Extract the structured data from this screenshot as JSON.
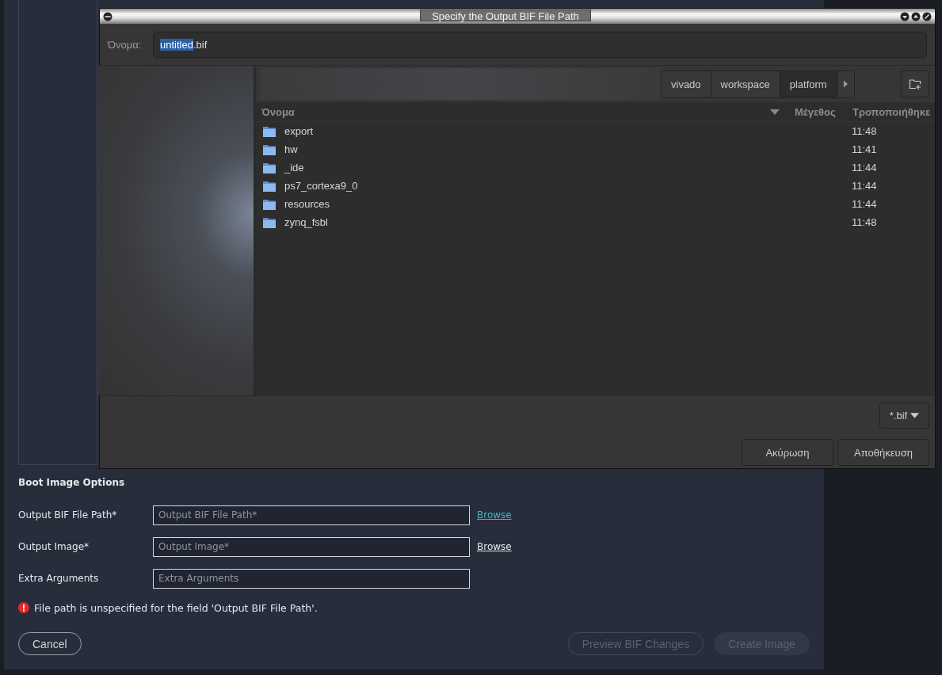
{
  "file_dialog": {
    "title": "Specify the Output BIF File Path",
    "name_label": "Όνομα:",
    "name_field": {
      "selected_text": "untitled",
      "rest_text": ".bif"
    },
    "breadcrumbs": [
      {
        "label": "vivado",
        "selected": false
      },
      {
        "label": "workspace",
        "selected": false
      },
      {
        "label": "platform",
        "selected": true
      }
    ],
    "columns": [
      "Όνομα",
      "Μέγεθος",
      "Τροποποιήθηκε"
    ],
    "files": [
      {
        "name": "export",
        "modified": "11:48"
      },
      {
        "name": "hw",
        "modified": "11:41"
      },
      {
        "name": "_ide",
        "modified": "11:44"
      },
      {
        "name": "ps7_cortexa9_0",
        "modified": "11:44"
      },
      {
        "name": "resources",
        "modified": "11:44"
      },
      {
        "name": "zynq_fsbl",
        "modified": "11:48"
      }
    ],
    "filter": "*.bif",
    "buttons": [
      "Ακύρωση",
      "Αποθήκευση"
    ]
  },
  "boot_image": {
    "heading": "Boot Image Options",
    "fields": [
      {
        "label": "Output BIF File Path*",
        "placeholder": "Output BIF File Path*",
        "browse": {
          "label": "Browse",
          "highlighted": true
        }
      },
      {
        "label": "Output Image*",
        "placeholder": "Output Image*",
        "browse": {
          "label": "Browse",
          "highlighted": false
        }
      },
      {
        "label": "Extra Arguments",
        "placeholder": "Extra Arguments"
      }
    ],
    "error": "File path is unspecified for the field 'Output BIF File Path'.",
    "buttons": [
      {
        "label": "Cancel",
        "kind": "outline",
        "disabled": false
      },
      {
        "label": "Preview BIF Changes",
        "kind": "outline",
        "disabled": true
      },
      {
        "label": "Create Image",
        "kind": "filled",
        "disabled": true
      }
    ]
  }
}
